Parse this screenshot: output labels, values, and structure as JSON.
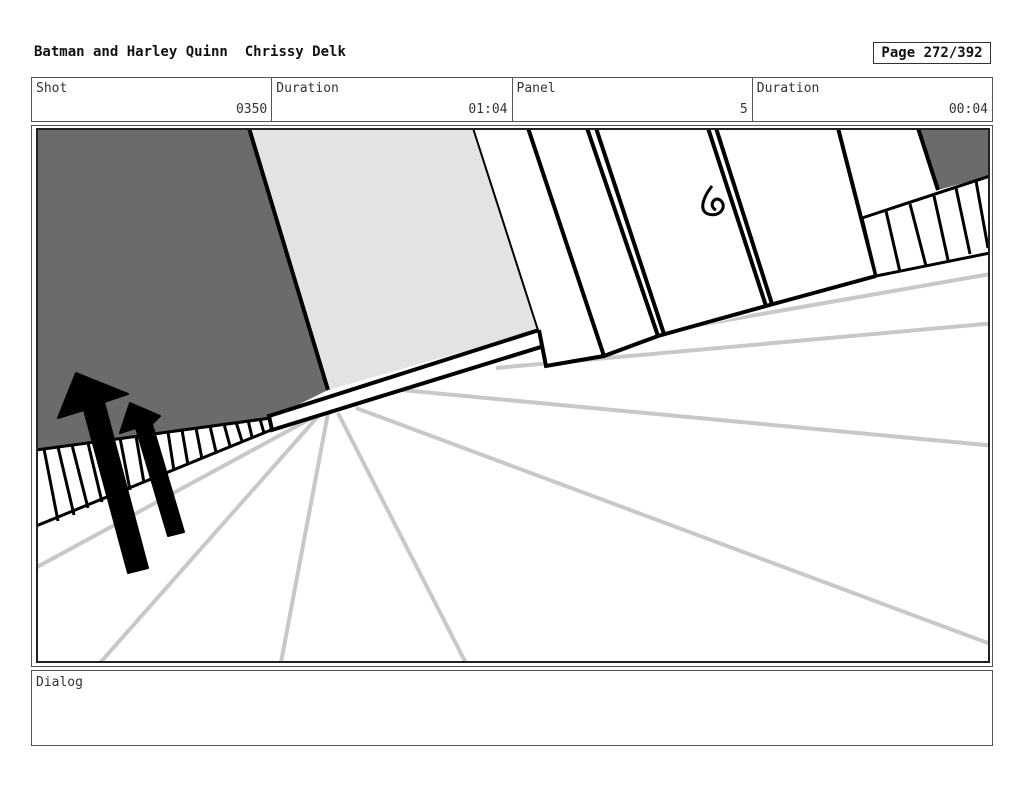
{
  "header": {
    "project": "Batman and Harley Quinn",
    "artist": "Chrissy Delk",
    "page": "Page 272/392"
  },
  "info": {
    "shot_label": "Shot",
    "shot_value": "0350",
    "duration_label": "Duration",
    "duration_value": "01:04",
    "panel_label": "Panel",
    "panel_value": "5",
    "panel_duration_label": "Duration",
    "panel_duration_value": "00:04"
  },
  "dialog": {
    "label": "Dialog"
  },
  "colors": {
    "dark_wall": "#6b6b6b",
    "light_wall": "#e3e3e3",
    "guide_line": "#c8c8c8",
    "ink": "#000000"
  }
}
